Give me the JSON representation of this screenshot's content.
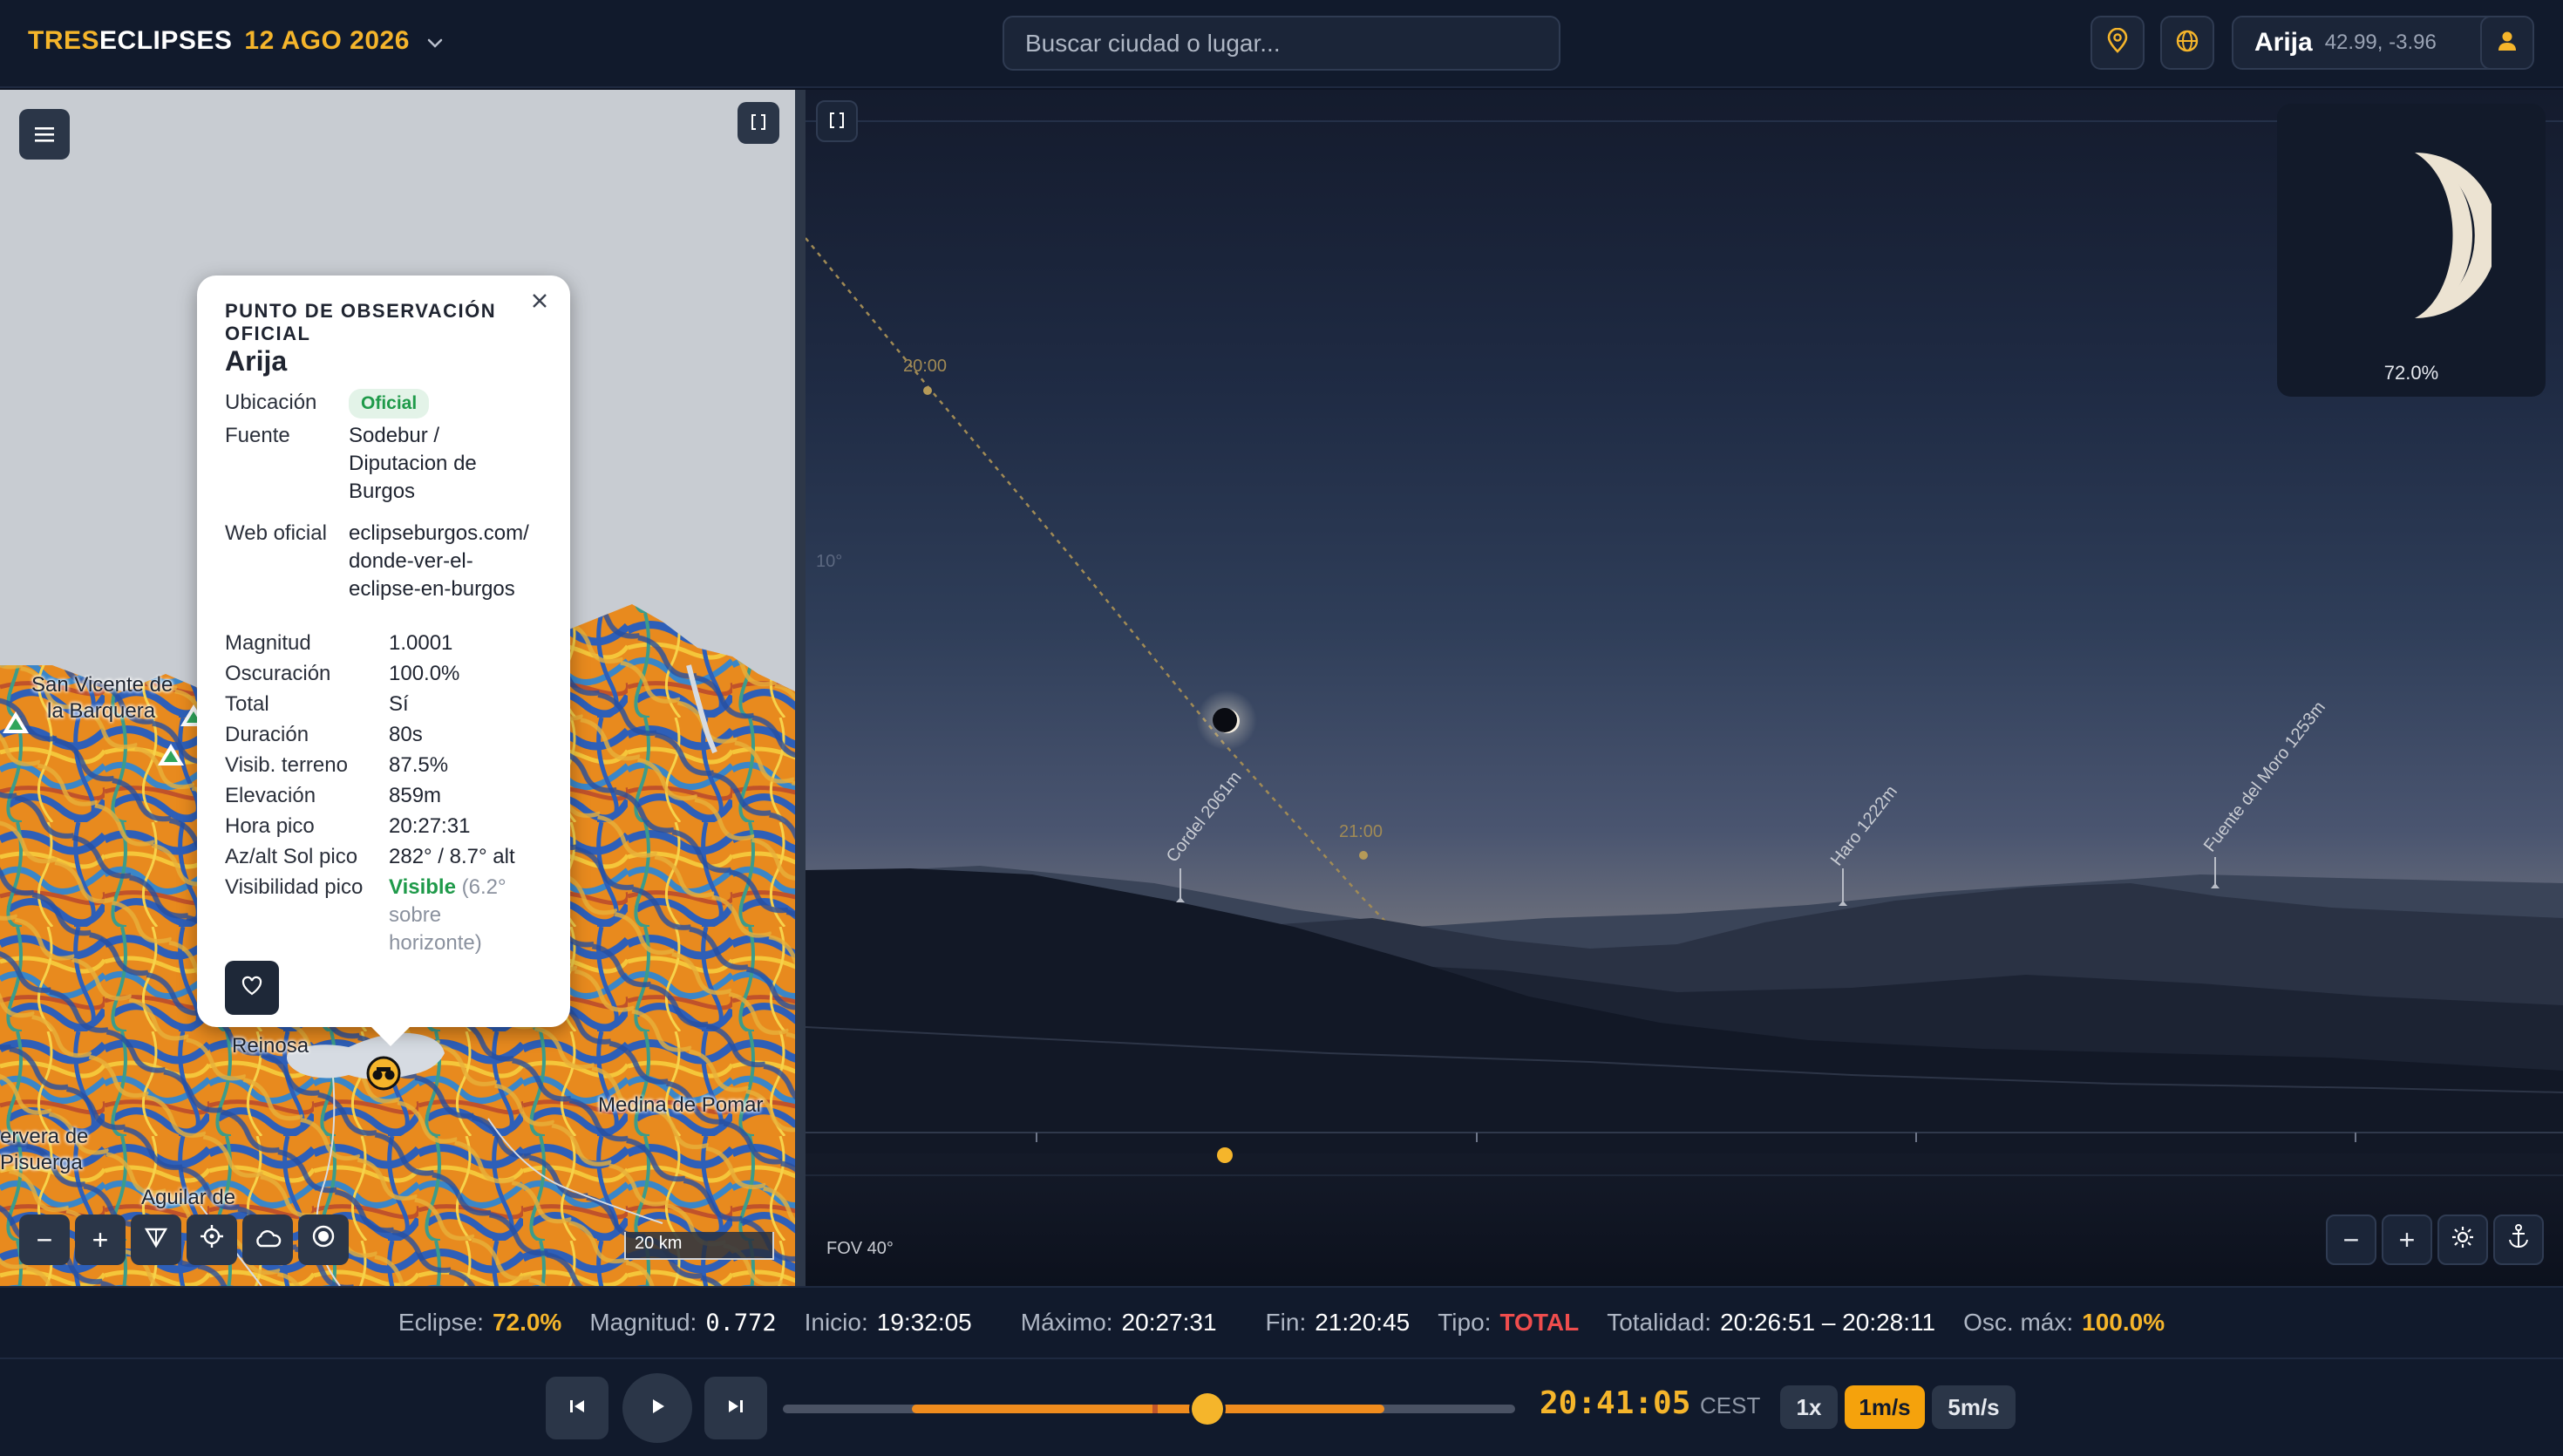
{
  "header": {
    "brand_part1": "TRES",
    "brand_part2": "ECLIPSES",
    "date": "12 AGO 2026",
    "search_placeholder": "Buscar ciudad o lugar...",
    "location_name": "Arija",
    "location_coords": "42.99, -3.96",
    "icons": [
      "pin-icon",
      "globe-icon",
      "user-icon"
    ]
  },
  "map": {
    "labels": {
      "san_vicente_1": "San Vicente de",
      "san_vicente_2": "la Barquera",
      "reinosa": "Reinosa",
      "medina": "Medina de Pomar",
      "cervera_1": "ervera de",
      "cervera_2": "Pisuerga",
      "aguilar": "Aguilar de"
    },
    "scale": "20 km",
    "controls": {
      "zoom_out": "−",
      "zoom_in": "+"
    }
  },
  "popup": {
    "title": "PUNTO DE OBSERVACIÓN OFICIAL",
    "name": "Arija",
    "ubicacion_label": "Ubicación",
    "ubicacion_badge": "Oficial",
    "fuente_label": "Fuente",
    "fuente_value": "Sodebur /\nDiputacion de\nBurgos",
    "web_label": "Web oficial",
    "web_value": "eclipseburgos.com/\ndonde-ver-el-\neclipse-en-burgos",
    "rows": [
      {
        "label": "Magnitud",
        "value": "1.0001"
      },
      {
        "label": "Oscuración",
        "value": "100.0%"
      },
      {
        "label": "Total",
        "value": "Sí"
      },
      {
        "label": "Duración",
        "value": "80s"
      },
      {
        "label": "Visib. terreno",
        "value": "87.5%"
      },
      {
        "label": "Elevación",
        "value": "859m"
      },
      {
        "label": "Hora pico",
        "value": "20:27:31"
      },
      {
        "label": "Az/alt Sol pico",
        "value": "282° / 8.7° alt"
      }
    ],
    "vis_label": "Visibilidad pico",
    "vis_strong": "Visible",
    "vis_muted": "(6.2°\nsobre\nhorizonte)"
  },
  "sky": {
    "altitude_label": "10°",
    "time_20": "20:00",
    "time_21": "21:00",
    "peaks": [
      "Cordel 2061m",
      "Haro 1222m",
      "Fuente del Moro 1253m"
    ],
    "moon_pct": "72.0%",
    "fov": "FOV 40°",
    "controls": {
      "zoom_out": "−",
      "zoom_in": "+"
    }
  },
  "status": {
    "eclipse_label": "Eclipse:",
    "eclipse_value": "72.0%",
    "magnitud_label": "Magnitud:",
    "magnitud_value": "0.772",
    "inicio_label": "Inicio:",
    "inicio_value": "19:32:05",
    "maximo_label": "Máximo:",
    "maximo_value": "20:27:31",
    "fin_label": "Fin:",
    "fin_value": "21:20:45",
    "tipo_label": "Tipo:",
    "tipo_value": "TOTAL",
    "totalidad_label": "Totalidad:",
    "totalidad_value": "20:26:51 – 20:28:11",
    "osc_label": "Osc. máx:",
    "osc_value": "100.0%"
  },
  "playback": {
    "clock": "20:41:05",
    "timezone": "CEST",
    "progress": 0.58,
    "speeds": [
      "1x",
      "1m/s",
      "5m/s"
    ],
    "active_speed": "1m/s"
  },
  "colors": {
    "accent": "#f5b52b",
    "total_red": "#ef4d4d",
    "visible_green": "#1f9a4a",
    "link_blue": "#2c6fdc"
  }
}
